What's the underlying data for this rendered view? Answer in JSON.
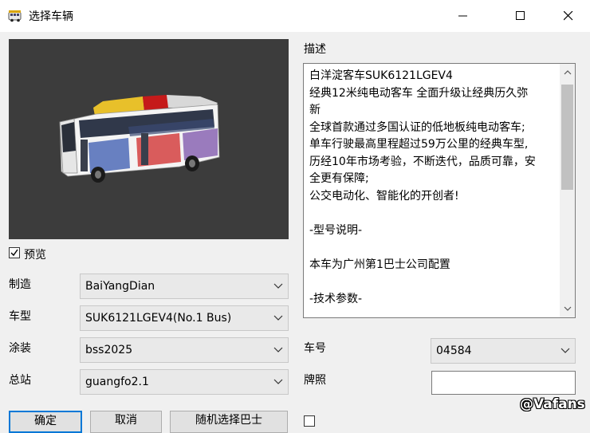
{
  "window": {
    "title": "选择车辆",
    "icon": "bus-icon",
    "controls": [
      "minimize-icon",
      "maximize-icon",
      "close-icon"
    ]
  },
  "preview": {
    "checkbox_label": "预览",
    "checked": true,
    "background": "#3c3c3c"
  },
  "form": {
    "manufacturer": {
      "label": "制造",
      "value": "BaiYangDian"
    },
    "model": {
      "label": "车型",
      "value": "SUK6121LGEV4(No.1 Bus)"
    },
    "livery": {
      "label": "涂装",
      "value": "bss2025"
    },
    "depot": {
      "label": "总站",
      "value": "guangfo2.1"
    }
  },
  "description": {
    "label": "描述",
    "lines": [
      "白洋淀客车SUK6121LGEV4",
      "经典12米纯电动客车 全面升级让经典历久弥",
      "新",
      "全球首款通过多国认证的低地板纯电动客车;",
      "单车行驶最高里程超过59万公里的经典车型,",
      "历经10年市场考验，不断迭代，品质可靠，安",
      "全更有保障;",
      "公交电动化、智能化的开创者!",
      "",
      "-型号说明-",
      "",
      "本车为广州第1巴士公司配置",
      "",
      "-技术参数-"
    ]
  },
  "vehicle": {
    "number_label": "车号",
    "number_value": "04584",
    "plate_label": "牌照",
    "plate_value": ""
  },
  "buttons": {
    "ok": "确定",
    "cancel": "取消",
    "random": "随机选择巴士"
  },
  "watermark": "@Vafans",
  "colors": {
    "accent": "#0078d7",
    "window_bg": "#f0f0f0"
  }
}
